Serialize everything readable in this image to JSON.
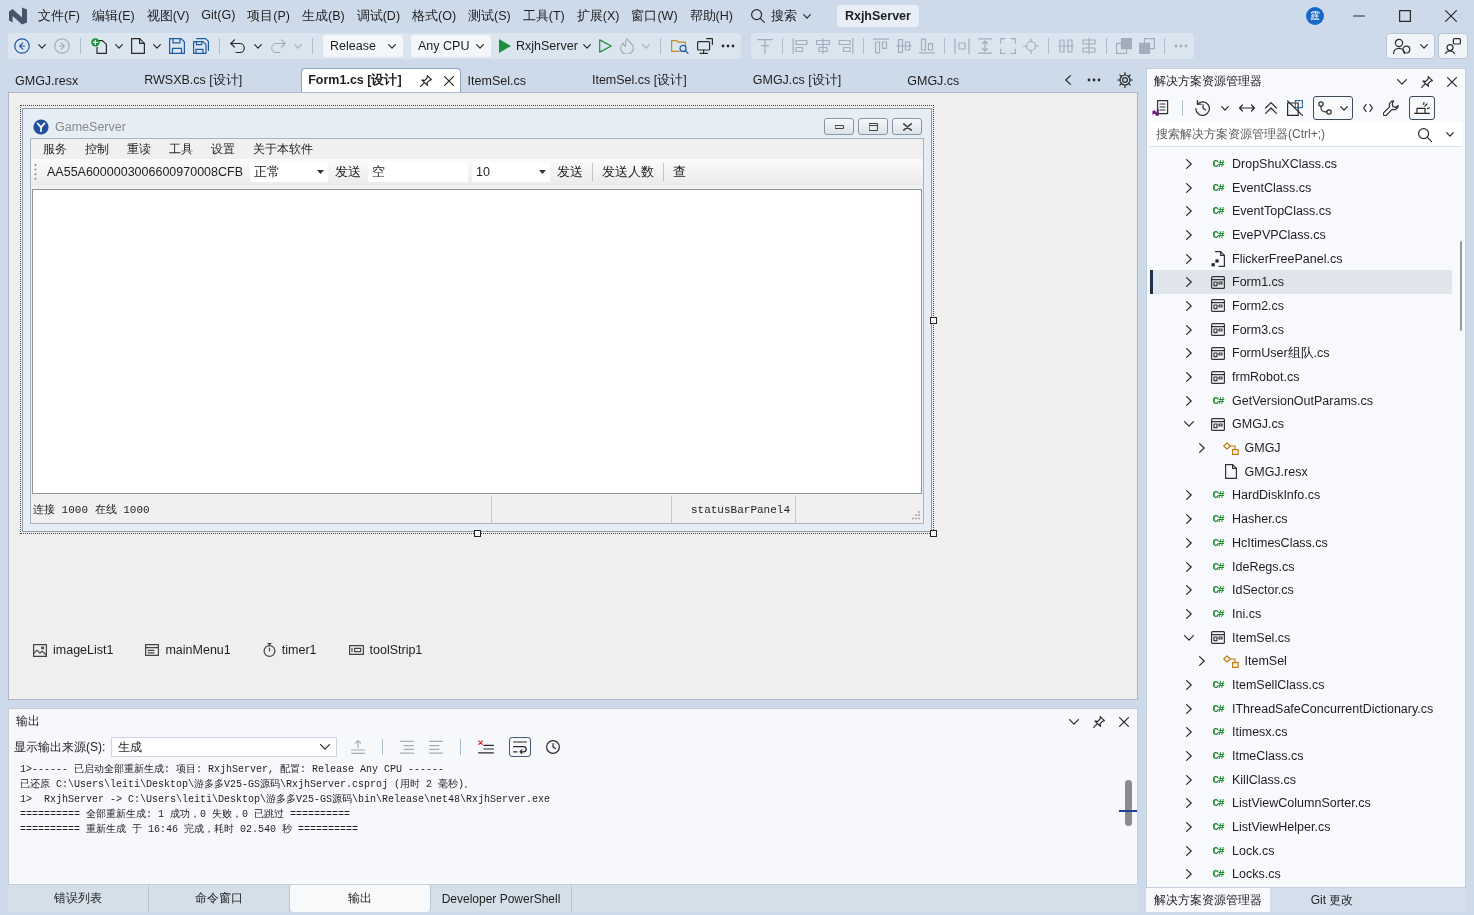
{
  "title_bar": {
    "menus": [
      "文件(F)",
      "编辑(E)",
      "视图(V)",
      "Git(G)",
      "项目(P)",
      "生成(B)",
      "调试(D)",
      "格式(O)",
      "测试(S)",
      "工具(T)",
      "扩展(X)",
      "窗口(W)",
      "帮助(H)"
    ],
    "search_label": "搜索",
    "solution_name": "RxjhServer",
    "avatar_initial": "霆"
  },
  "toolbar": {
    "configuration": "Release",
    "platform": "Any CPU",
    "start_target": "RxjhServer"
  },
  "document_tabs": [
    {
      "label": "GMGJ.resx",
      "selected": false
    },
    {
      "label": "RWSXB.cs [设计]",
      "selected": false
    },
    {
      "label": "Form1.cs [设计]",
      "selected": true
    },
    {
      "label": "ItemSel.cs",
      "selected": false
    },
    {
      "label": "ItemSel.cs [设计]",
      "selected": false
    },
    {
      "label": "GMGJ.cs [设计]",
      "selected": false
    },
    {
      "label": "GMGJ.cs",
      "selected": false
    }
  ],
  "designer": {
    "form": {
      "title": "GameServer",
      "menu": [
        "服务",
        "控制",
        "重读",
        "工具",
        "设置",
        "关于本软件"
      ],
      "toolstrip": [
        {
          "kind": "label",
          "text": "AA55A6000003006600970008CFB"
        },
        {
          "kind": "combo",
          "text": "正常"
        },
        {
          "kind": "button",
          "text": "发送"
        },
        {
          "kind": "textbox",
          "text": "空"
        },
        {
          "kind": "combo",
          "text": "10"
        },
        {
          "kind": "button",
          "text": "发送"
        },
        {
          "kind": "separator"
        },
        {
          "kind": "button",
          "text": "发送人数"
        },
        {
          "kind": "separator"
        },
        {
          "kind": "button",
          "text": "查"
        }
      ],
      "status_panels": [
        "连接 1000 在线 1000",
        "statusBarPanel4"
      ]
    },
    "components": [
      {
        "kind": "imagelist",
        "name": "imageList1"
      },
      {
        "kind": "menu",
        "name": "mainMenu1"
      },
      {
        "kind": "timer",
        "name": "timer1"
      },
      {
        "kind": "toolstrip",
        "name": "toolStrip1"
      }
    ]
  },
  "output": {
    "title": "输出",
    "source_label": "显示输出来源(S):",
    "source": "生成",
    "lines": [
      "1>------ 已启动全部重新生成: 项目: RxjhServer, 配置: Release Any CPU ------",
      "已还原 C:\\Users\\leiti\\Desktop\\游多多V25-GS源码\\RxjhServer.csproj (用时 2 毫秒)。",
      "1>  RxjhServer -> C:\\Users\\leiti\\Desktop\\游多多V25-GS源码\\bin\\Release\\net48\\RxjhServer.exe",
      "========== 全部重新生成: 1 成功，0 失败，0 已跳过 ==========",
      "========== 重新生成 于 16:46 完成，耗时 02.540 秒 =========="
    ]
  },
  "bottom_tabs": [
    {
      "label": "错误列表",
      "selected": false
    },
    {
      "label": "命令窗口",
      "selected": false
    },
    {
      "label": "输出",
      "selected": true
    },
    {
      "label": "Developer PowerShell",
      "selected": false
    }
  ],
  "solution_explorer": {
    "title": "解决方案资源管理器",
    "search_placeholder": "搜索解决方案资源管理器(Ctrl+;)",
    "items": [
      {
        "label": "DropShuXClass.cs",
        "kind": "csharp",
        "icon_text": "C#",
        "expanded": false,
        "selected": false
      },
      {
        "label": "EventClass.cs",
        "kind": "csharp",
        "icon_text": "C#",
        "expanded": false,
        "selected": false
      },
      {
        "label": "EventTopClass.cs",
        "kind": "csharp",
        "icon_text": "C#",
        "expanded": false,
        "selected": false
      },
      {
        "label": "EvePVPClass.cs",
        "kind": "csharp",
        "icon_text": "C#",
        "expanded": false,
        "selected": false
      },
      {
        "label": "FlickerFreePanel.cs",
        "kind": "component",
        "expanded": false,
        "selected": false
      },
      {
        "label": "Form1.cs",
        "kind": "form",
        "expanded": false,
        "selected": true
      },
      {
        "label": "Form2.cs",
        "kind": "form",
        "expanded": false,
        "selected": false
      },
      {
        "label": "Form3.cs",
        "kind": "form",
        "expanded": false,
        "selected": false
      },
      {
        "label": "FormUser组队.cs",
        "kind": "form",
        "expanded": false,
        "selected": false
      },
      {
        "label": "frmRobot.cs",
        "kind": "form",
        "expanded": false,
        "selected": false
      },
      {
        "label": "GetVersionOutParams.cs",
        "kind": "csharp",
        "icon_text": "C#",
        "expanded": false,
        "selected": false
      },
      {
        "label": "GMGJ.cs",
        "kind": "form",
        "expanded": true,
        "selected": false,
        "children": [
          {
            "label": "GMGJ",
            "kind": "class",
            "expanded": false,
            "selected": false
          },
          {
            "label": "GMGJ.resx",
            "kind": "resx",
            "selected": false
          }
        ]
      },
      {
        "label": "HardDiskInfo.cs",
        "kind": "csharp",
        "icon_text": "C#",
        "expanded": false,
        "selected": false
      },
      {
        "label": "Hasher.cs",
        "kind": "csharp",
        "icon_text": "C#",
        "expanded": false,
        "selected": false
      },
      {
        "label": "HcItimesClass.cs",
        "kind": "csharp",
        "icon_text": "C#",
        "expanded": false,
        "selected": false
      },
      {
        "label": "IdeRegs.cs",
        "kind": "csharp",
        "icon_text": "C#",
        "expanded": false,
        "selected": false
      },
      {
        "label": "IdSector.cs",
        "kind": "csharp",
        "icon_text": "C#",
        "expanded": false,
        "selected": false
      },
      {
        "label": "Ini.cs",
        "kind": "csharp",
        "icon_text": "C#",
        "expanded": false,
        "selected": false
      },
      {
        "label": "ItemSel.cs",
        "kind": "form",
        "expanded": true,
        "selected": false,
        "children": [
          {
            "label": "ItemSel",
            "kind": "class",
            "expanded": false,
            "selected": false
          }
        ]
      },
      {
        "label": "ItemSellClass.cs",
        "kind": "csharp",
        "icon_text": "C#",
        "expanded": false,
        "selected": false
      },
      {
        "label": "IThreadSafeConcurrentDictionary.cs",
        "kind": "csharp",
        "icon_text": "C#",
        "expanded": false,
        "selected": false
      },
      {
        "label": "Itimesx.cs",
        "kind": "csharp",
        "icon_text": "C#",
        "expanded": false,
        "selected": false
      },
      {
        "label": "ItmeClass.cs",
        "kind": "csharp",
        "icon_text": "C#",
        "expanded": false,
        "selected": false
      },
      {
        "label": "KillClass.cs",
        "kind": "csharp",
        "icon_text": "C#",
        "expanded": false,
        "selected": false
      },
      {
        "label": "ListViewColumnSorter.cs",
        "kind": "csharp",
        "icon_text": "C#",
        "expanded": false,
        "selected": false
      },
      {
        "label": "ListViewHelper.cs",
        "kind": "csharp",
        "icon_text": "C#",
        "expanded": false,
        "selected": false
      },
      {
        "label": "Lock.cs",
        "kind": "csharp",
        "icon_text": "C#",
        "expanded": false,
        "selected": false
      },
      {
        "label": "Locks.cs",
        "kind": "csharp",
        "icon_text": "C#",
        "expanded": false,
        "selected": false
      }
    ]
  },
  "solution_explorer_tabs": [
    {
      "label": "解决方案资源管理器",
      "selected": true
    },
    {
      "label": "Git 更改",
      "selected": false
    }
  ]
}
